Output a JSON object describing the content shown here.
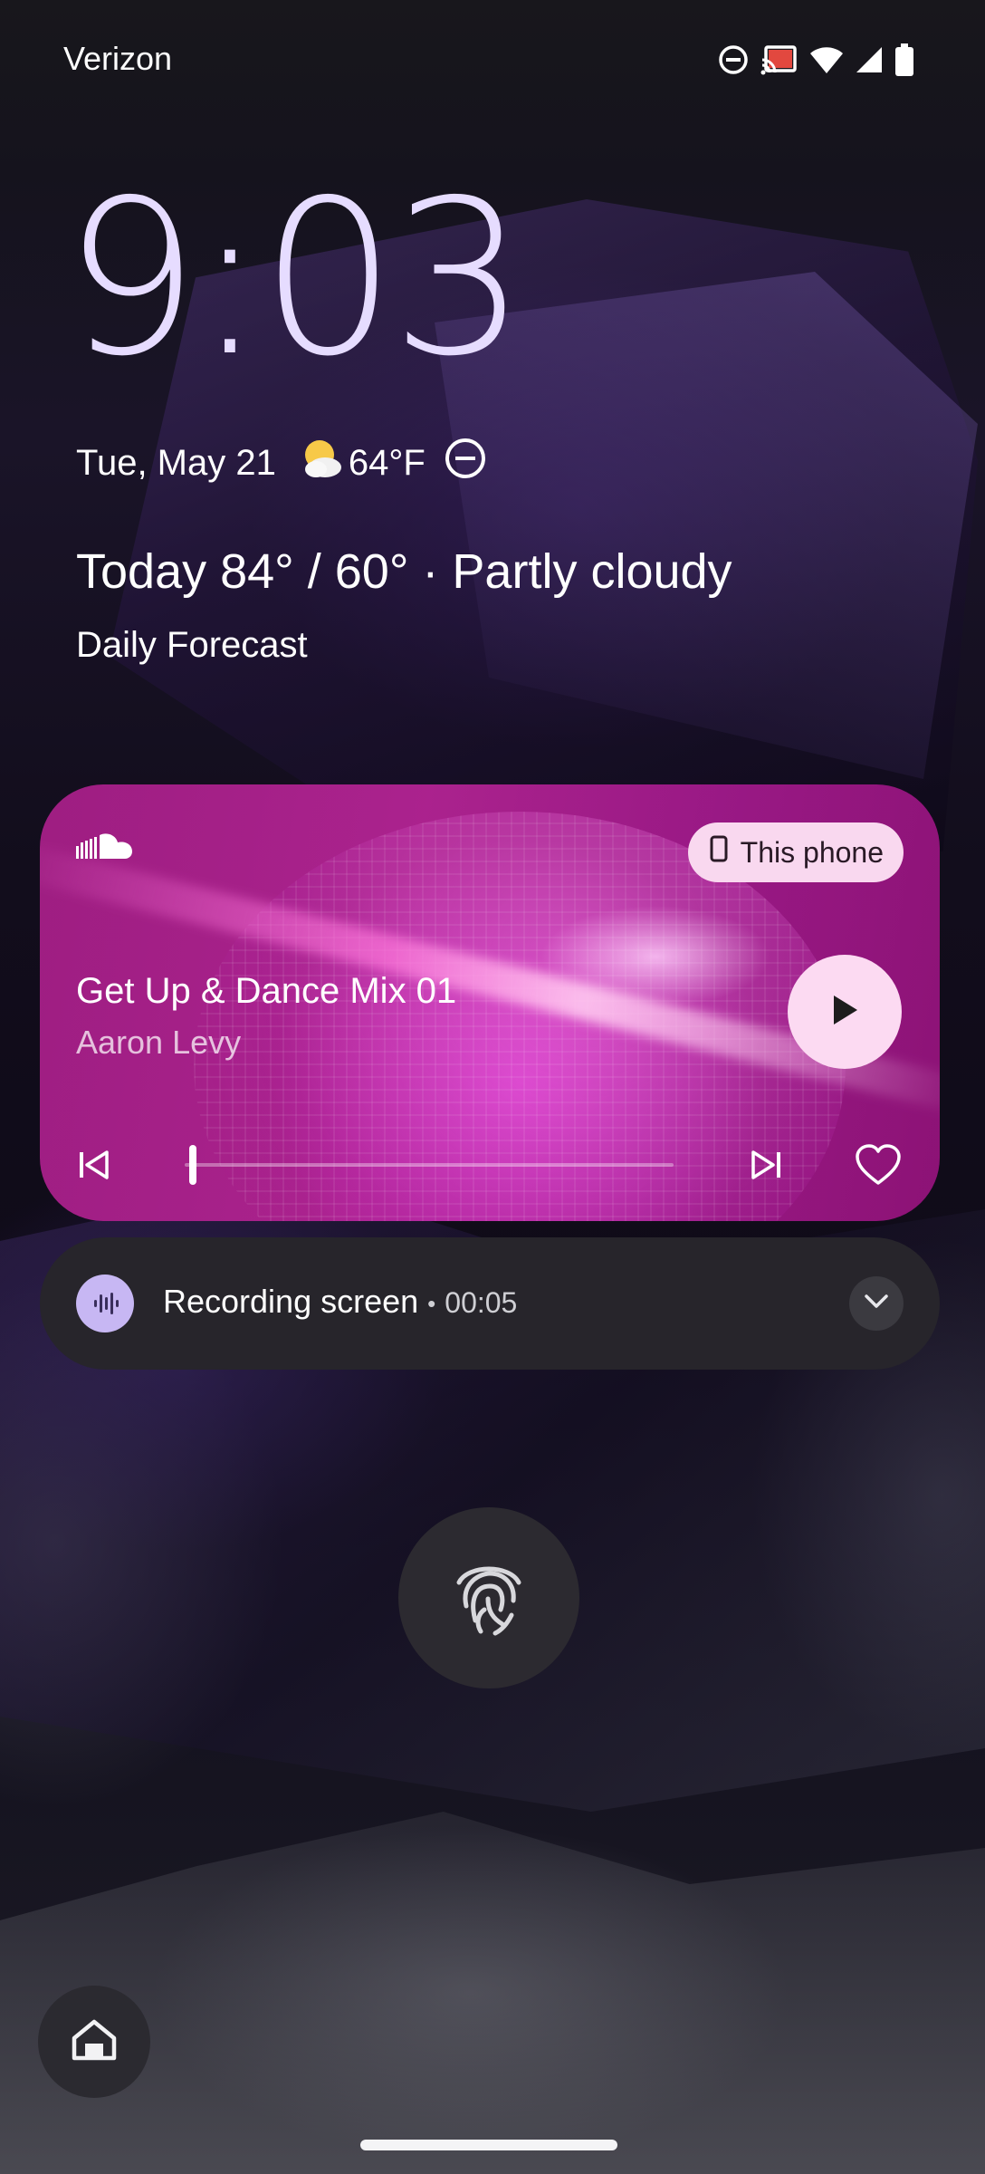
{
  "status_bar": {
    "carrier": "Verizon",
    "icons": [
      "do-not-disturb-icon",
      "cast-icon",
      "wifi-icon",
      "cell-signal-icon",
      "battery-icon"
    ]
  },
  "lockscreen": {
    "time": "9:03",
    "date": "Tue, May 21",
    "temperature": "64°F",
    "weather_icon": "partly-cloudy-icon",
    "forecast": "Today 84° / 60° · Partly cloudy",
    "daily_forecast_label": "Daily Forecast"
  },
  "media": {
    "app_icon": "soundcloud-icon",
    "output_device": "This phone",
    "title": "Get Up & Dance Mix 01",
    "artist": "Aaron Levy",
    "progress_fraction": 0.01,
    "accent_color": "#a0207f",
    "button_color": "#fcdaf2"
  },
  "notification": {
    "title": "Recording screen",
    "elapsed": "00:05",
    "icon": "audio-waveform-icon",
    "icon_bg": "#c7b7f3"
  },
  "colors": {
    "clock": "#e6dcff",
    "notification_bg": "#27252b"
  }
}
